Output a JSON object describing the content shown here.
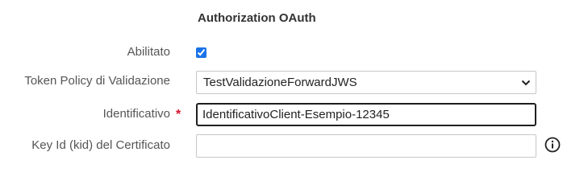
{
  "section": {
    "title": "Authorization OAuth"
  },
  "fields": {
    "enabled": {
      "label": "Abilitato",
      "checked": true
    },
    "token_policy": {
      "label": "Token Policy di Validazione",
      "selected": "TestValidazioneForwardJWS"
    },
    "identifier": {
      "label": "Identificativo",
      "required_marker": "*",
      "value": "IdentificativoClient-Esempio-12345"
    },
    "key_id": {
      "label": "Key Id (kid) del Certificato",
      "value": ""
    }
  },
  "icons": {
    "select_arrow": "chevron-down-icon",
    "help": "info-icon"
  },
  "colors": {
    "accent": "#1a73e8",
    "required": "#d6142a",
    "focus_border": "#1f1f1f"
  }
}
